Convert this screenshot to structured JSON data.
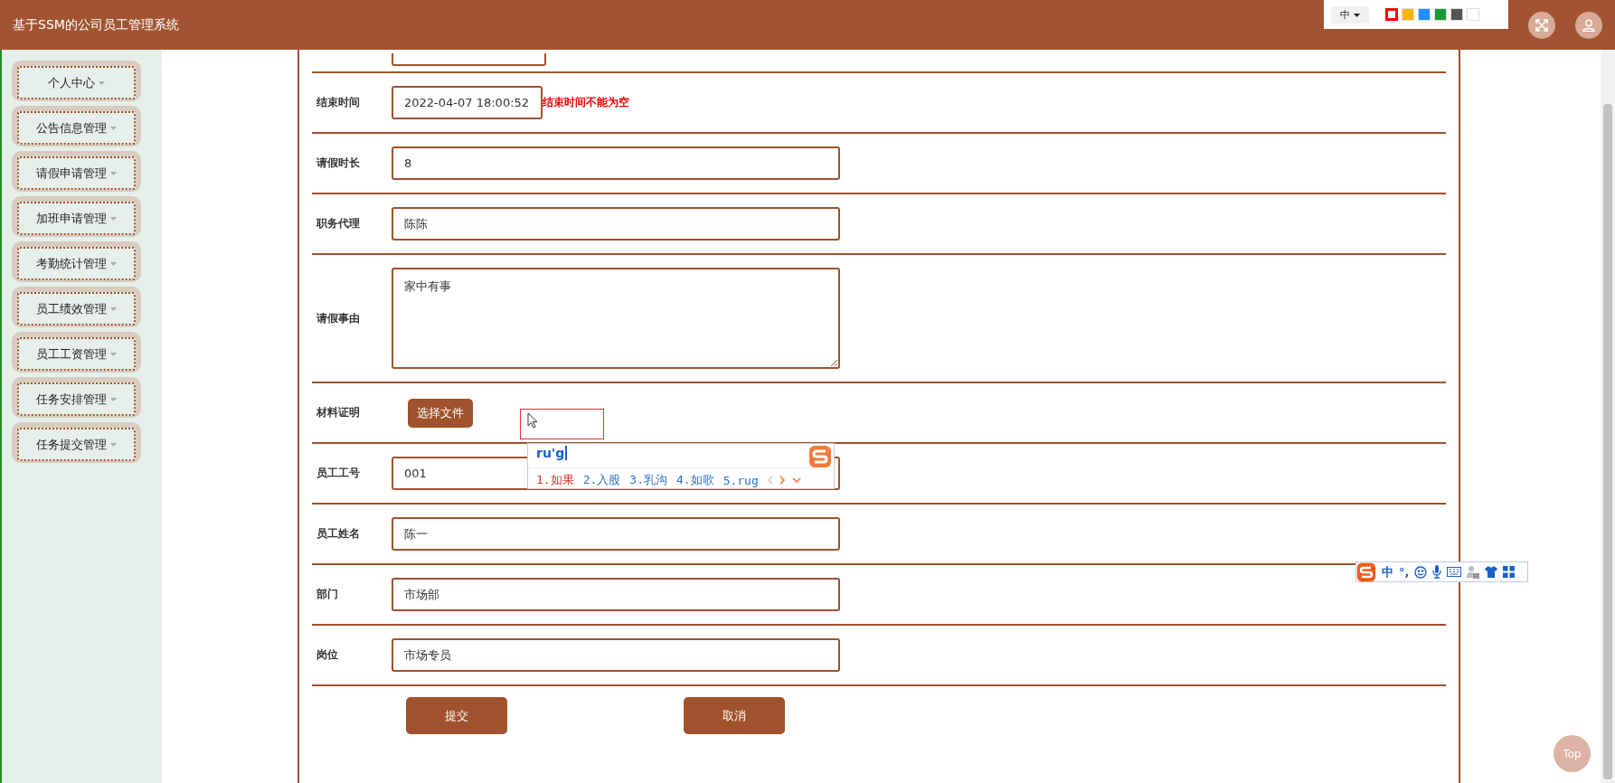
{
  "header": {
    "title": "基于SSM的公司员工管理系统",
    "lang": "中",
    "swatches": [
      {
        "color": "#ff0000",
        "selected": true
      },
      {
        "color": "#ffb400",
        "selected": false
      },
      {
        "color": "#1e90ff",
        "selected": false
      },
      {
        "color": "#1a9a3a",
        "selected": false
      },
      {
        "color": "#555555",
        "selected": false
      },
      {
        "color": "#ffffff",
        "selected": false
      }
    ]
  },
  "sidebar": {
    "items": [
      "个人中心",
      "公告信息管理",
      "请假申请管理",
      "加班申请管理",
      "考勤统计管理",
      "员工绩效管理",
      "员工工资管理",
      "任务安排管理",
      "任务提交管理"
    ]
  },
  "form": {
    "fields": [
      {
        "kind": "date",
        "label": "结束时间",
        "value": "2022-04-07 18:00:52",
        "error": "结束时间不能为空"
      },
      {
        "kind": "text",
        "label": "请假时长",
        "value": "8"
      },
      {
        "kind": "text",
        "label": "职务代理",
        "value": "陈陈"
      },
      {
        "kind": "textarea",
        "label": "请假事由",
        "value": "家中有事"
      },
      {
        "kind": "file",
        "label": "材料证明",
        "button": "选择文件"
      },
      {
        "kind": "text",
        "label": "员工工号",
        "value": "001"
      },
      {
        "kind": "text",
        "label": "员工姓名",
        "value": "陈一"
      },
      {
        "kind": "text",
        "label": "部门",
        "value": "市场部"
      },
      {
        "kind": "text",
        "label": "岗位",
        "value": "市场专员"
      }
    ],
    "buttons": [
      "提交",
      "取消"
    ]
  },
  "ime": {
    "input": "ru'g",
    "candidates": [
      {
        "text": "1.如果",
        "selected": true
      },
      {
        "text": "2.入股",
        "selected": false
      },
      {
        "text": "3.乳沟",
        "selected": false
      },
      {
        "text": "4.如歌",
        "selected": false
      },
      {
        "text": "5.rug",
        "selected": false
      }
    ]
  },
  "ime_toolbar": {
    "mode": "中",
    "punct": "°,"
  },
  "top_button": "Top"
}
